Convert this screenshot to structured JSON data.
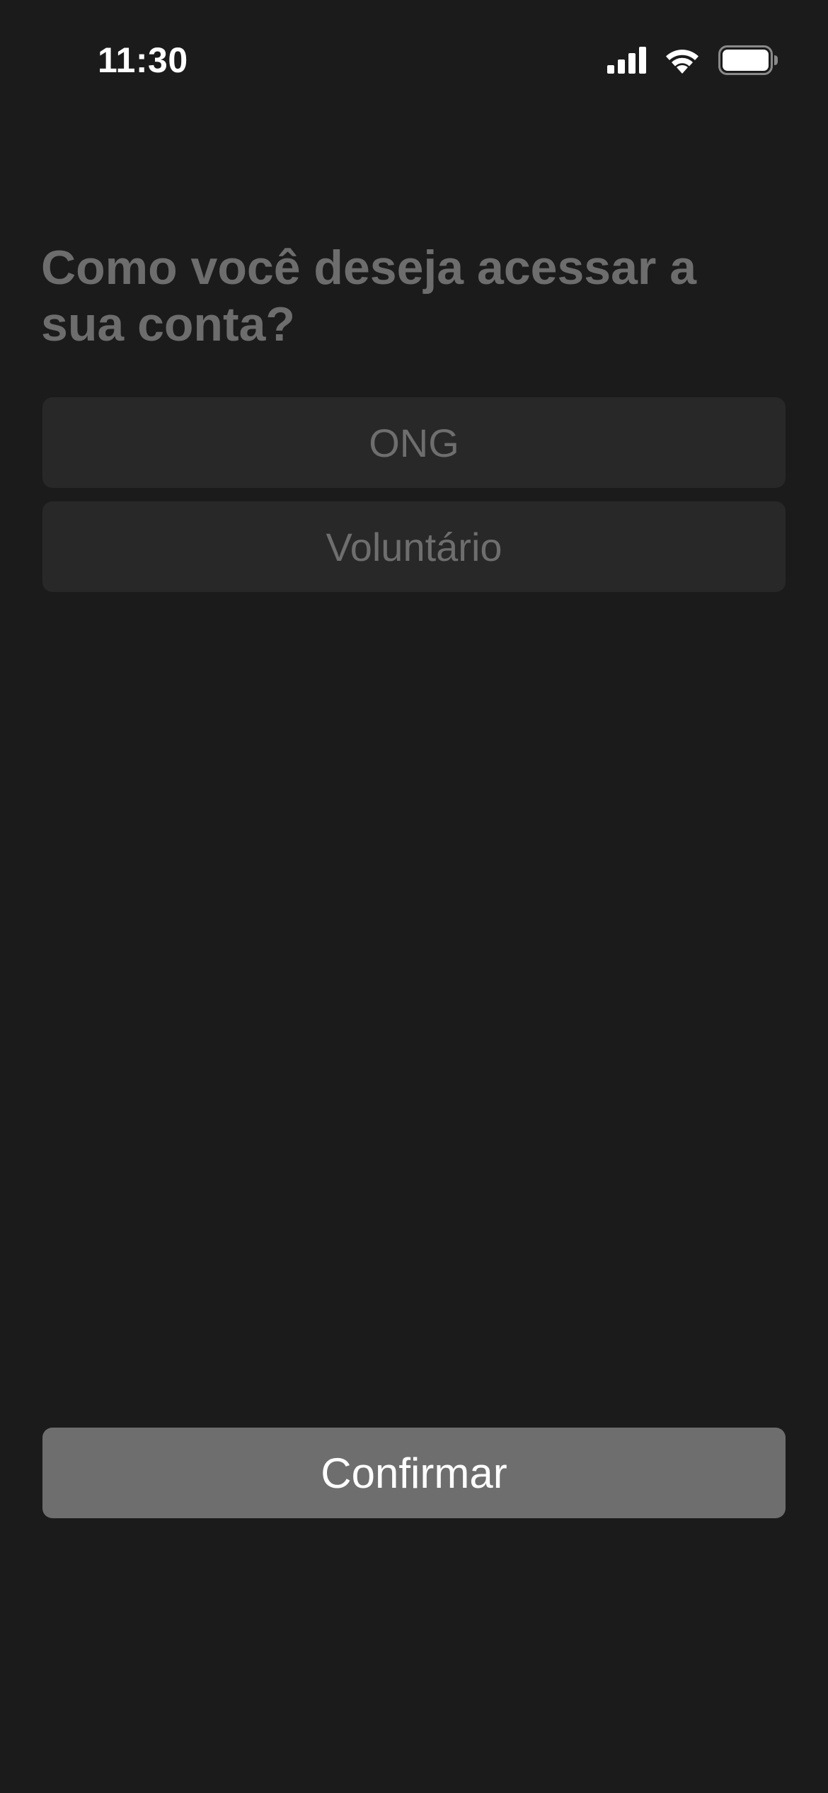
{
  "status_bar": {
    "time": "11:30",
    "icons": [
      "signal-icon",
      "wifi-icon",
      "battery-icon"
    ],
    "battery_level": 1.0
  },
  "main": {
    "title": "Como você deseja acessar a sua conta?",
    "options": [
      {
        "label": "ONG"
      },
      {
        "label": "Voluntário"
      }
    ]
  },
  "footer": {
    "confirm_label": "Confirmar"
  },
  "colors": {
    "background": "#1b1b1b",
    "option_background": "#282828",
    "muted_text": "#6e6e6e",
    "button_background": "#6e6e6e",
    "button_text": "#ffffff"
  }
}
